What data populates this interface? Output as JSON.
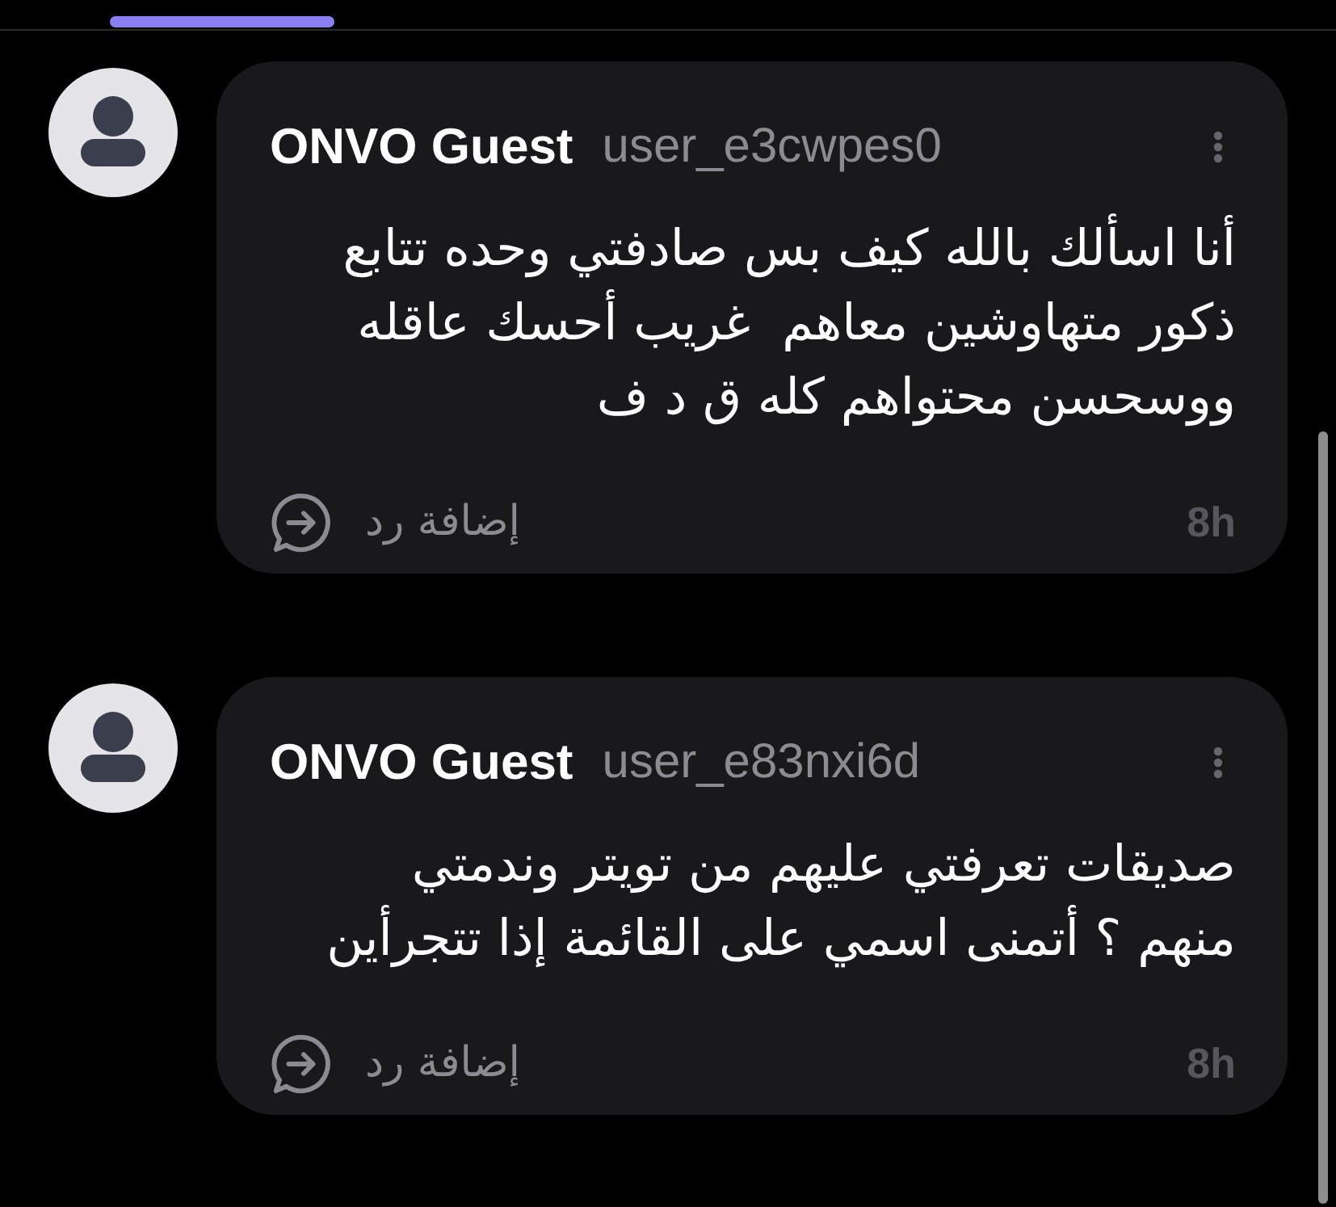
{
  "comments": [
    {
      "display_name": "ONVO Guest",
      "username": "user_e3cwpes0",
      "text": "أنا اسألك بالله كيف بس صادفتي وحده تتابع ذكور متهاوشين معاهم  غريب أحسك عاقله ووسحسن محتواهم كله ق د ف",
      "reply_label": "إضافة رد",
      "time": "8h"
    },
    {
      "display_name": "ONVO Guest",
      "username": "user_e83nxi6d",
      "text": "صديقات تعرفتي عليهم من تويتر وندمتي منهم ؟ أتمنى اسمي على القائمة إذا تتجرأين",
      "reply_label": "إضافة رد",
      "time": "8h"
    }
  ]
}
